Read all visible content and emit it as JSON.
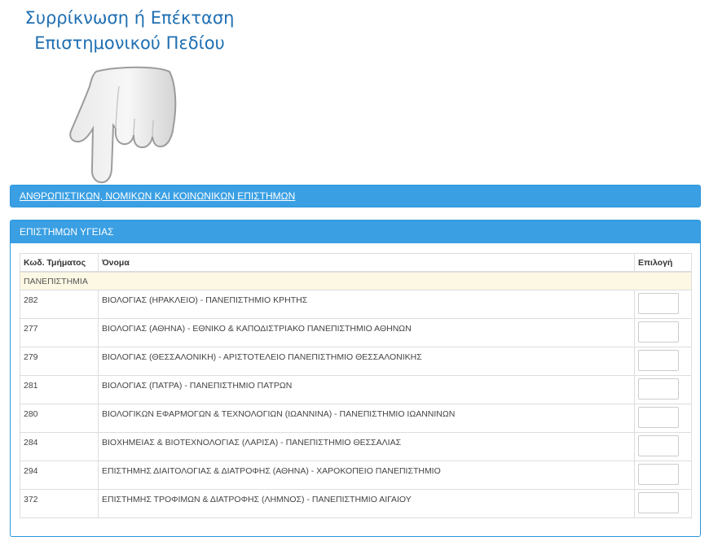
{
  "overlay": {
    "title_line1": "Συρρίκνωση ή Επέκταση",
    "title_line2": "Επιστημονικού Πεδίου",
    "pointer_icon": "pointing-hand-icon"
  },
  "sections": [
    {
      "title": "ΑΝΘΡΩΠΙΣΤΙΚΩΝ, ΝΟΜΙΚΩΝ ΚΑΙ ΚΟΙΝΩΝΙΚΩΝ ΕΠΙΣΤΗΜΩΝ",
      "expanded": false
    },
    {
      "title": "ΕΠΙΣΤΗΜΩΝ ΥΓΕΙΑΣ",
      "expanded": true
    }
  ],
  "table": {
    "columns": [
      "Κωδ. Τμήματος",
      "Όνομα",
      "Επιλογή"
    ],
    "group_label": "ΠΑΝΕΠΙΣΤΗΜΙΑ",
    "rows": [
      {
        "code": "282",
        "name": "ΒΙΟΛΟΓΙΑΣ (ΗΡΑΚΛΕΙΟ) - ΠΑΝΕΠΙΣΤΗΜΙΟ ΚΡΗΤΗΣ",
        "choice": ""
      },
      {
        "code": "277",
        "name": "ΒΙΟΛΟΓΙΑΣ (ΑΘΗΝΑ) - ΕΘΝΙΚΟ & ΚΑΠΟΔΙΣΤΡΙΑΚΟ ΠΑΝΕΠΙΣΤΗΜΙΟ ΑΘΗΝΩΝ",
        "choice": ""
      },
      {
        "code": "279",
        "name": "ΒΙΟΛΟΓΙΑΣ (ΘΕΣΣΑΛΟΝΙΚΗ) - ΑΡΙΣΤΟΤΕΛΕΙΟ ΠΑΝΕΠΙΣΤΗΜΙΟ ΘΕΣΣΑΛΟΝΙΚΗΣ",
        "choice": ""
      },
      {
        "code": "281",
        "name": "ΒΙΟΛΟΓΙΑΣ (ΠΑΤΡΑ) - ΠΑΝΕΠΙΣΤΗΜΙΟ ΠΑΤΡΩΝ",
        "choice": ""
      },
      {
        "code": "280",
        "name": "ΒΙΟΛΟΓΙΚΩΝ ΕΦΑΡΜΟΓΩΝ & ΤΕΧΝΟΛΟΓΙΩΝ (ΙΩΑΝΝΙΝΑ) - ΠΑΝΕΠΙΣΤΗΜΙΟ ΙΩΑΝΝΙΝΩΝ",
        "choice": ""
      },
      {
        "code": "284",
        "name": "ΒΙΟΧΗΜΕΙΑΣ & ΒΙΟΤΕΧΝΟΛΟΓΙΑΣ (ΛΑΡΙΣΑ) - ΠΑΝΕΠΙΣΤΗΜΙΟ ΘΕΣΣΑΛΙΑΣ",
        "choice": ""
      },
      {
        "code": "294",
        "name": "ΕΠΙΣΤΗΜΗΣ ΔΙΑΙΤΟΛΟΓΙΑΣ & ΔΙΑΤΡΟΦΗΣ (ΑΘΗΝΑ) - ΧΑΡΟΚΟΠΕΙΟ ΠΑΝΕΠΙΣΤΗΜΙΟ",
        "choice": ""
      },
      {
        "code": "372",
        "name": "ΕΠΙΣΤΗΜΗΣ ΤΡΟΦΙΜΩΝ & ΔΙΑΤΡΟΦΗΣ (ΛΗΜΝΟΣ) - ΠΑΝΕΠΙΣΤΗΜΙΟ ΑΙΓΑΙΟΥ",
        "choice": ""
      }
    ]
  }
}
